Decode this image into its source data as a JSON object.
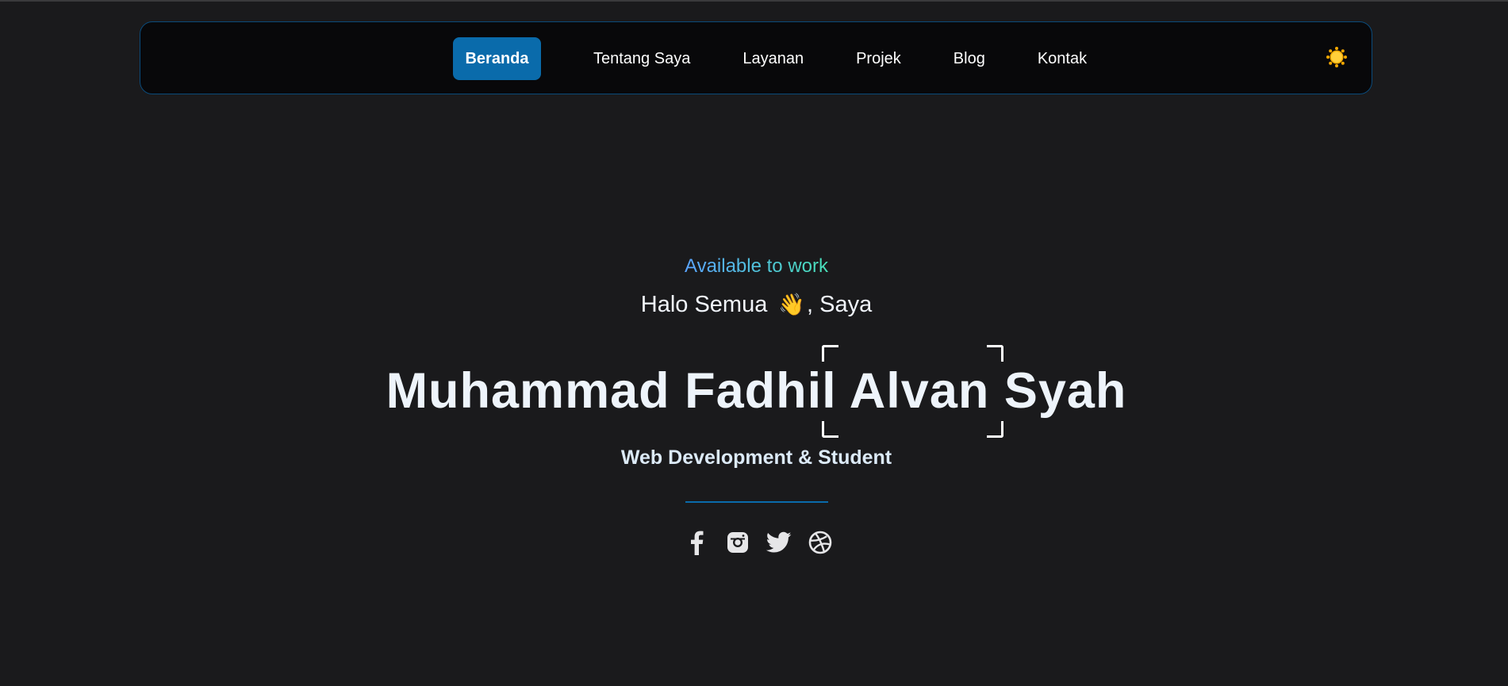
{
  "nav": {
    "items": [
      {
        "label": "Beranda",
        "active": true
      },
      {
        "label": "Tentang Saya",
        "active": false
      },
      {
        "label": "Layanan",
        "active": false
      },
      {
        "label": "Projek",
        "active": false
      },
      {
        "label": "Blog",
        "active": false
      },
      {
        "label": "Kontak",
        "active": false
      }
    ],
    "theme_toggle_icon": "sun-icon"
  },
  "hero": {
    "availability": "Available to work",
    "greeting_prefix": "Halo Semua",
    "wave_emoji": "👋",
    "greeting_suffix": ", Saya",
    "name": "Muhammad Fadhil Alvan Syah",
    "role": "Web Development & Student",
    "socials": [
      {
        "icon": "facebook-icon"
      },
      {
        "icon": "instagram-icon"
      },
      {
        "icon": "twitter-icon"
      },
      {
        "icon": "dribbble-icon"
      }
    ]
  },
  "colors": {
    "background": "#1a1a1c",
    "navbar_bg": "#08080a",
    "navbar_border": "#0a4a7a",
    "accent": "#0a6bab",
    "gradient_start": "#5aa4ff",
    "gradient_end": "#48e0b8",
    "sun": "#f5b400"
  }
}
